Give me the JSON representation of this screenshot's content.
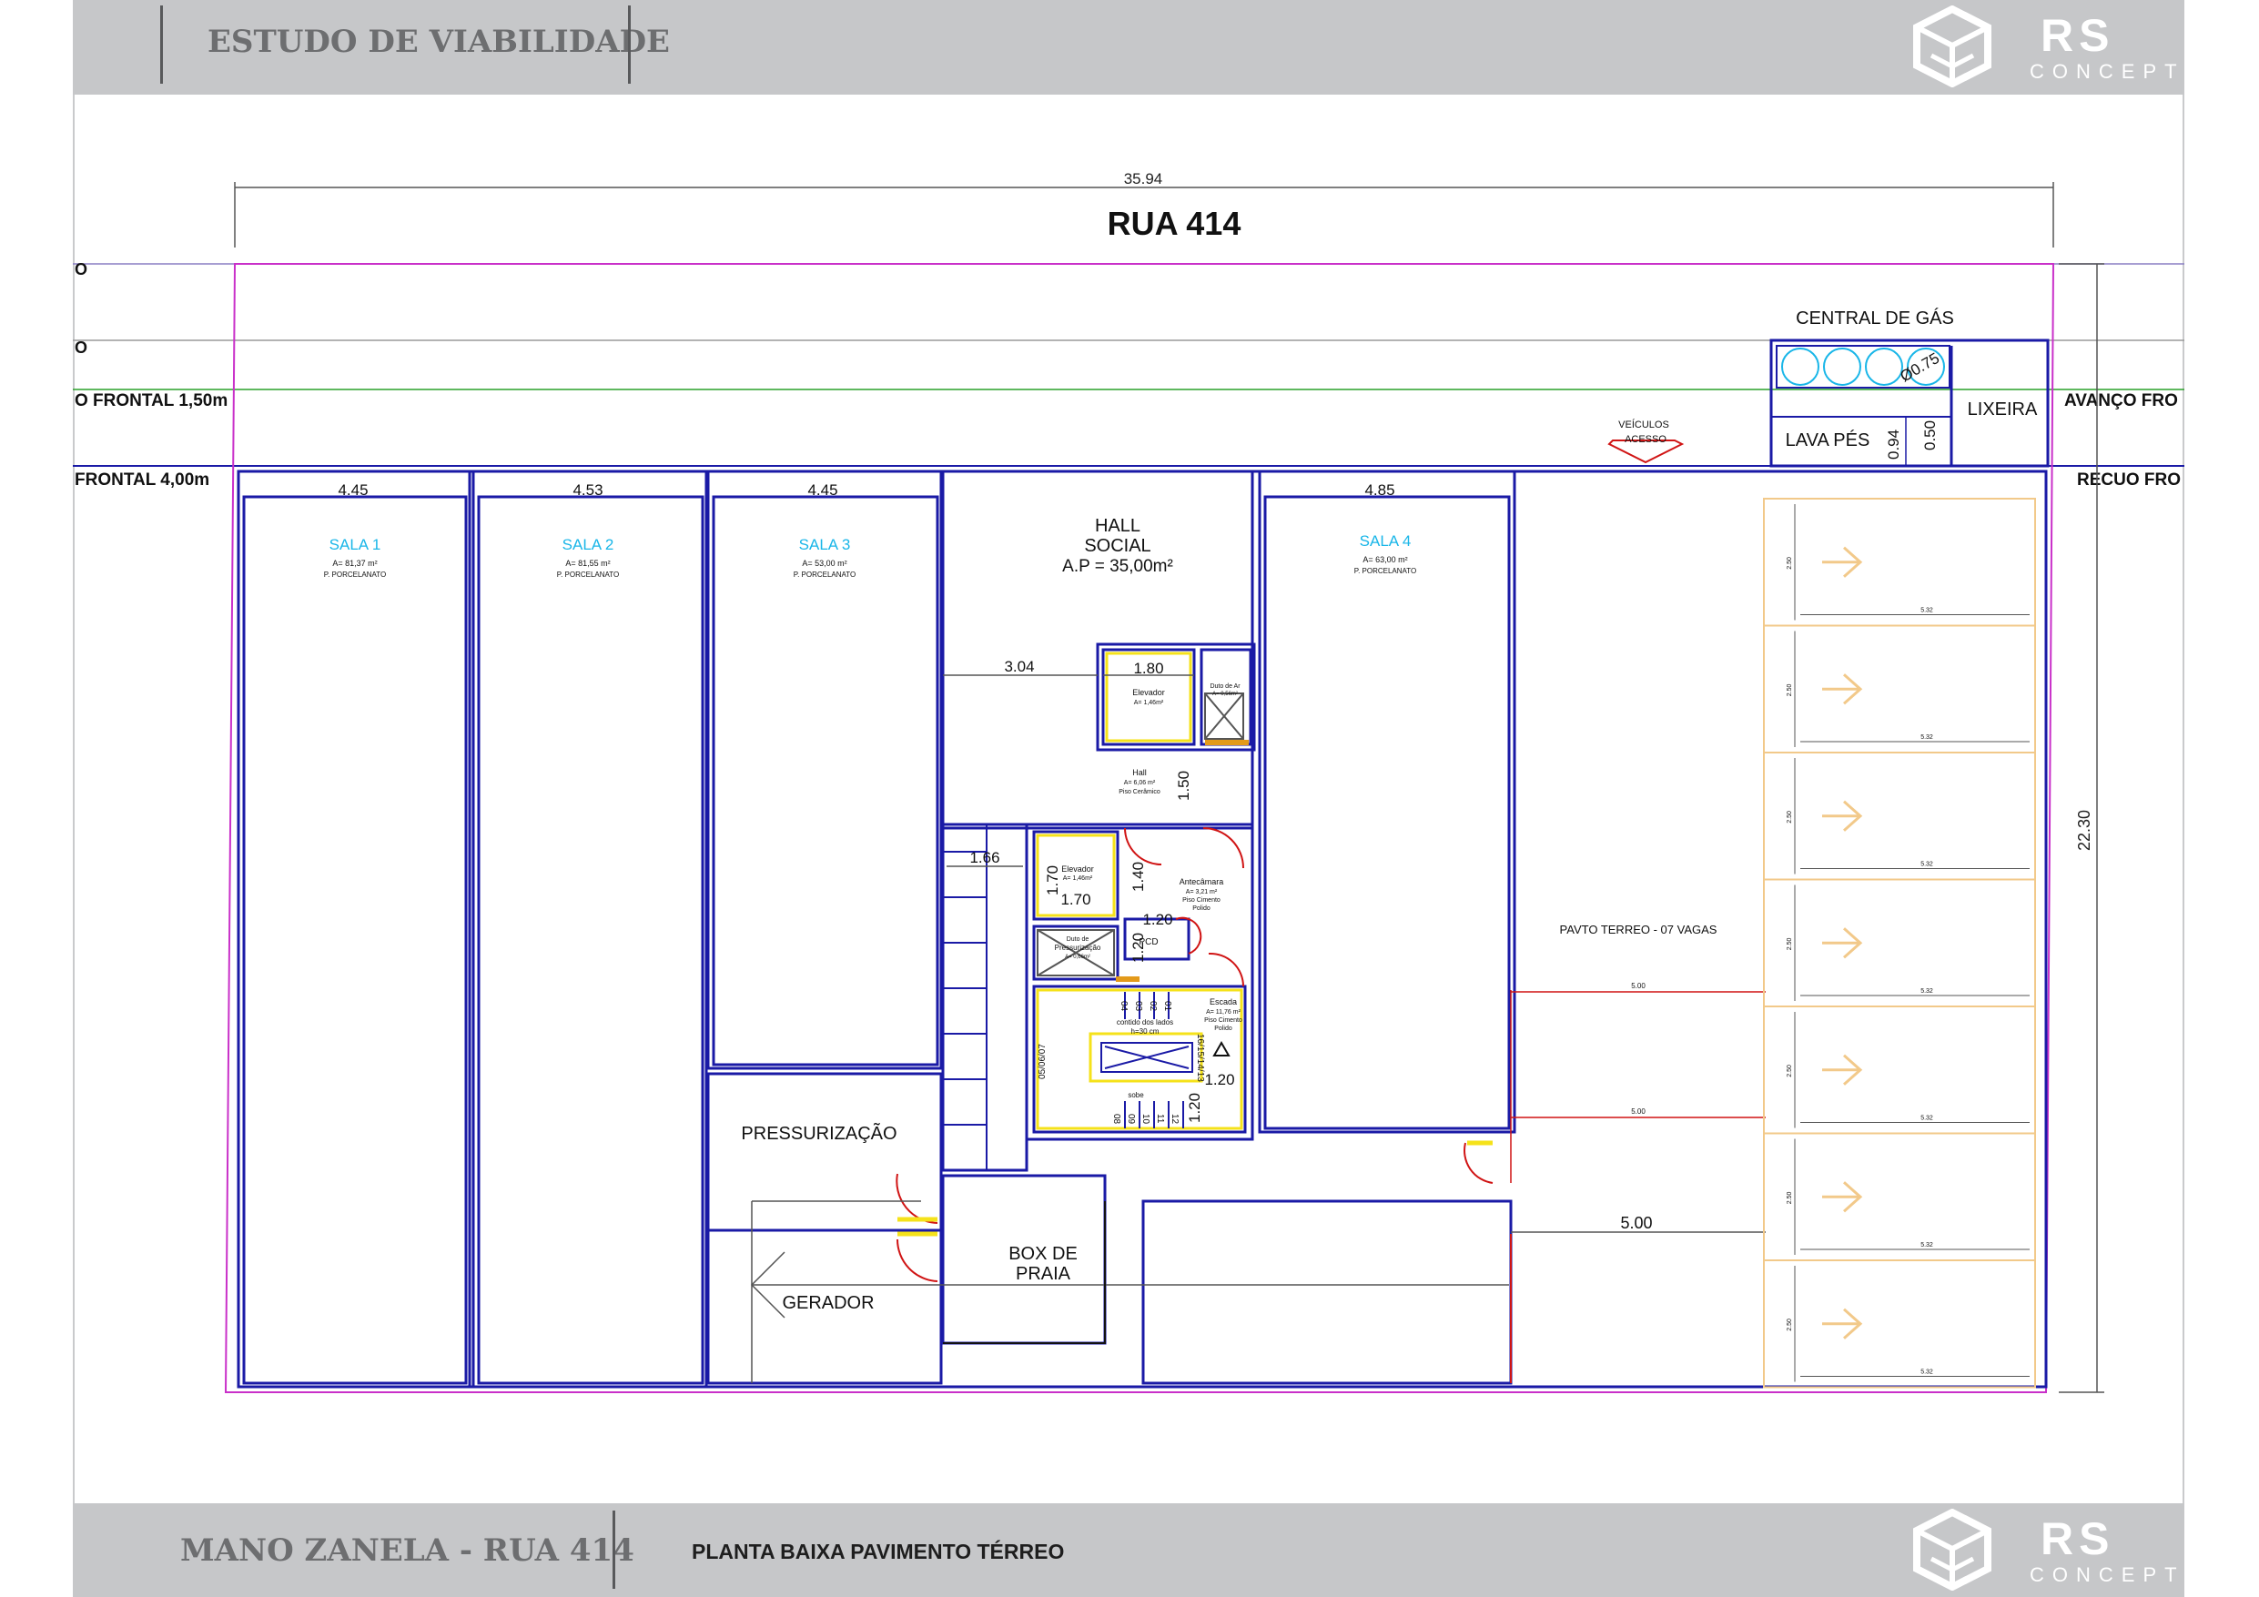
{
  "header": {
    "title": "ESTUDO DE VIABILIDADE",
    "logo_main": "RS",
    "logo_sub": "CONCEPT"
  },
  "footer": {
    "project": "MANO ZANELA - RUA 414",
    "sheet": "PLANTA BAIXA PAVIMENTO TÉRREO",
    "logo_main": "RS",
    "logo_sub": "CONCEPT"
  },
  "plan": {
    "street": "RUA 414",
    "total_width": "35.94",
    "total_depth": "22.30",
    "line_frontal_left_top": "O",
    "line_frontal_left_mid": "O",
    "avanco_left": "O FRONTAL 1,50m",
    "recuo_left": "FRONTAL 4,00m",
    "avanco_right": "AVANÇO FRO",
    "recuo_right": "RECUO FRO",
    "central_gas": "CENTRAL DE GÁS",
    "gas_dim": "Ø0.75",
    "lava_pes": "LAVA PÉS",
    "lava_dim_a": "0.94",
    "lava_dim_b": "0.50",
    "lixeira": "LIXEIRA",
    "veiculos": "VEÍCULOS",
    "acesso": "ACESSO",
    "rooms": [
      {
        "name": "SALA 1",
        "width": "4.45",
        "area": "A= 81,37 m²",
        "floor": "P. PORCELANATO"
      },
      {
        "name": "SALA 2",
        "width": "4.53",
        "area": "A= 81,55 m²",
        "floor": "P. PORCELANATO"
      },
      {
        "name": "SALA 3",
        "width": "4.45",
        "area": "A= 53,00 m²",
        "floor": "P. PORCELANATO"
      },
      {
        "name": "SALA 4",
        "width": "4.85",
        "area": "A= 63,00 m²",
        "floor": "P. PORCELANATO"
      }
    ],
    "hall_social_1": "HALL",
    "hall_social_2": "SOCIAL",
    "hall_social_area": "A.P = 35,00m²",
    "dim_304": "3.04",
    "dim_180": "1.80",
    "elevador": "Elevador",
    "elevador_area": "A= 1,46m²",
    "duto_ar": "Duto de Ar",
    "duto_ar_area": "A= 0,56m²",
    "hall_small": "Hall",
    "hall_small_area": "A= 6,06 m²",
    "hall_small_floor": "Piso Cerâmico",
    "dim_150": "1.50",
    "dim_166": "1.66",
    "dim_170a": "1.70",
    "dim_170b": "1.70",
    "dim_140": "1.40",
    "elevador2": "Elevador",
    "elevador2_area": "A= 1,46m²",
    "antecamara": "Antecâmara",
    "antecamara_area": "A= 3,21 m²",
    "antecamara_floor_1": "Piso Cimento",
    "antecamara_floor_2": "Polido",
    "dim_120a": "1.20",
    "dim_120b": "1.20",
    "dim_120c": "1.20",
    "dim_120d": "1.20",
    "duto_press": "Duto de",
    "duto_press_2": "Pressurização",
    "duto_press_area": "A= 0,66m²",
    "pcd": "PCD",
    "escada": "Escada",
    "escada_area": "A= 11,76 m²",
    "escada_floor_1": "Piso Cimento",
    "escada_floor_2": "Polido",
    "espelho_1": "contido dos lados",
    "espelho_2": "h=30 cm",
    "stairs_top": [
      "04",
      "03",
      "02",
      "01"
    ],
    "stairs_bottom": [
      "08",
      "09",
      "10",
      "11",
      "12"
    ],
    "stairs_left": "05/06/07",
    "stairs_right": "16/15/14/13",
    "sobe": "sobe",
    "pressurizacao": "PRESSURIZAÇÃO",
    "gerador": "GERADOR",
    "box_praia_1": "BOX DE",
    "box_praia_2": "PRAIA",
    "garage_label": "PAVTO TERREO  -  07  VAGAS",
    "dim_500_big": "5.00",
    "dim_500_small": "5.00",
    "vaga_w": "2.50",
    "vaga_l": "5.32"
  },
  "colors": {
    "wall": "#1a1aa6",
    "pink": "#c930c9",
    "red": "#d01414",
    "yellow": "#f5e21a",
    "cyan": "#19b6e8",
    "green": "#2aa02a",
    "parking": "#f2c98a",
    "dim": "#555555"
  }
}
